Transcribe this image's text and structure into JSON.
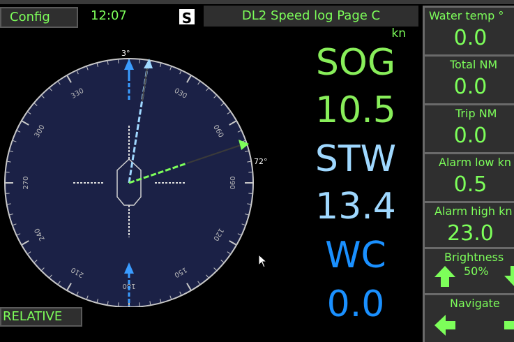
{
  "header": {
    "config_label": "Config",
    "clock": "12:07",
    "s_badge": "S",
    "page_title": "DL2 Speed log Page C"
  },
  "compass": {
    "heading_label": "3°",
    "wind_angle_label": "72°",
    "ticks": [
      "000",
      "030",
      "060",
      "090",
      "120",
      "150",
      "180",
      "210",
      "240",
      "270",
      "300",
      "330"
    ],
    "mode_label": "RELATIVE"
  },
  "readouts": {
    "unit": "kn",
    "sog_label": "SOG",
    "sog_value": "10.5",
    "stw_label": "STW",
    "stw_value": "13.4",
    "wc_label": "WC",
    "wc_value": "0.0"
  },
  "sidebar": {
    "items": [
      {
        "label": "Water temp °",
        "value": "0.0"
      },
      {
        "label": "Total NM",
        "value": "0.0"
      },
      {
        "label": "Trip NM",
        "value": "0.0"
      },
      {
        "label": "Alarm low kn",
        "value": "0.5"
      },
      {
        "label": "Alarm high kn",
        "value": "23.0"
      }
    ],
    "brightness_label": "Brightness",
    "brightness_value": "50%",
    "navigate_label": "Navigate"
  },
  "colors": {
    "accent_green": "#7dff5a",
    "sog_green": "#88ee5a",
    "stw_lightblue": "#9fd8ff",
    "wc_blue": "#1a90ff",
    "dial_navy": "#1b2146"
  }
}
